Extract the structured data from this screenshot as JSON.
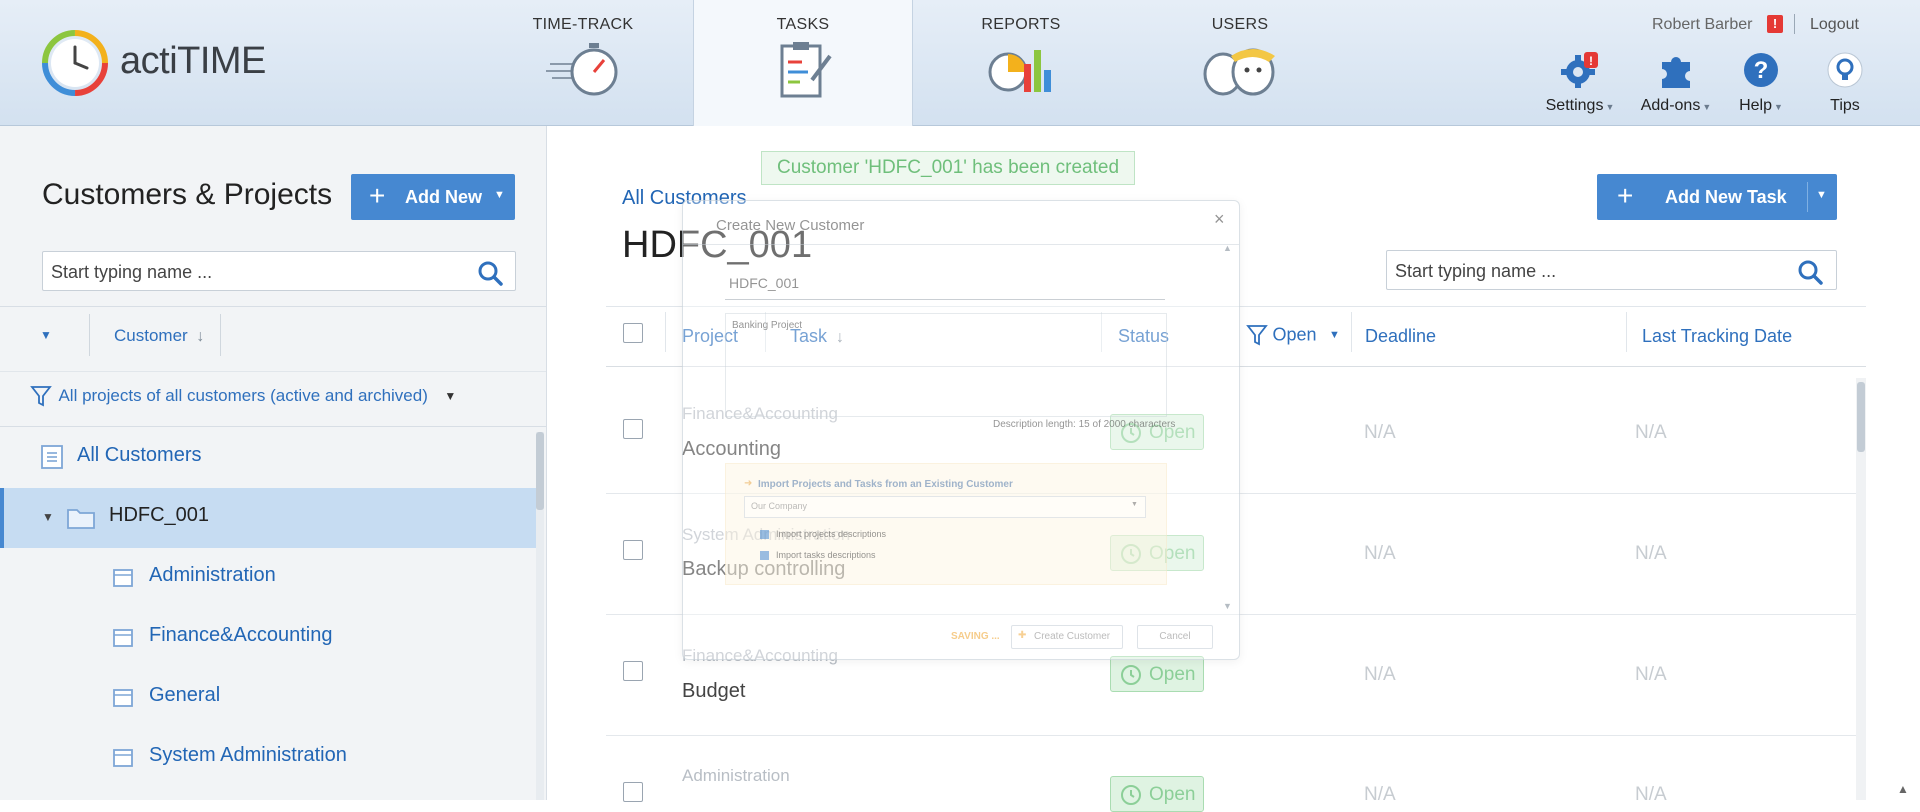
{
  "header": {
    "logo_text": "actiTIME",
    "tabs": [
      {
        "label": "TIME-TRACK"
      },
      {
        "label": "TASKS"
      },
      {
        "label": "REPORTS"
      },
      {
        "label": "USERS"
      }
    ],
    "user_name": "Robert Barber",
    "logout_label": "Logout",
    "tools": [
      {
        "label": "Settings"
      },
      {
        "label": "Add-ons"
      },
      {
        "label": "Help"
      },
      {
        "label": "Tips"
      }
    ]
  },
  "left_panel": {
    "title": "Customers & Projects",
    "add_new_label": "Add New",
    "search_placeholder": "Start typing name ...",
    "sort_label": "Customer",
    "filter_label": "All projects of all customers (active and archived)",
    "tree": {
      "all_customers": "All Customers",
      "customer": "HDFC_001",
      "projects": [
        "Administration",
        "Finance&Accounting",
        "General",
        "System Administration"
      ]
    }
  },
  "main": {
    "breadcrumb": "All Customers",
    "title": "HDFC_001",
    "add_task_label": "Add New Task",
    "search_placeholder": "Start typing name ...",
    "columns": {
      "project": "Project",
      "task": "Task",
      "status": "Status",
      "status_filter": "Open",
      "deadline": "Deadline",
      "last_tracking": "Last Tracking Date"
    },
    "rows": [
      {
        "project": "Finance&Accounting",
        "task": "Accounting",
        "status": "Open",
        "deadline": "N/A",
        "last_tracking": "N/A"
      },
      {
        "project": "System Administration",
        "task": "Backup controlling",
        "status": "Open",
        "deadline": "N/A",
        "last_tracking": "N/A"
      },
      {
        "project": "Finance&Accounting",
        "task": "Budget",
        "status": "Open",
        "deadline": "N/A",
        "last_tracking": "N/A"
      },
      {
        "project": "Administration",
        "task": "",
        "status": "Open",
        "deadline": "N/A",
        "last_tracking": "N/A"
      }
    ]
  },
  "toast": "Customer 'HDFC_001' has been created",
  "modal": {
    "title": "Create New Customer",
    "close_glyph": "×",
    "name_value": "HDFC_001",
    "description_value": "Banking Project",
    "description_length": "Description length: 15 of 2000 characters",
    "import_title": "Import Projects and Tasks from an Existing Customer",
    "import_select": "Our Company",
    "import_projects_label": "Import projects descriptions",
    "import_tasks_label": "Import tasks descriptions",
    "saving_label": "SAVING ...",
    "create_label": "Create Customer",
    "cancel_label": "Cancel"
  },
  "colors": {
    "brand_blue": "#4688d1",
    "link_blue": "#2266b5",
    "status_green": "#8ccf98",
    "toast_green": "#6fbf7b",
    "alert_red": "#e53935"
  },
  "icons": [
    "clock-logo-icon",
    "stopwatch-icon",
    "clipboard-icon",
    "pie-chart-icon",
    "users-icon",
    "gear-icon",
    "puzzle-icon",
    "help-icon",
    "bulb-icon",
    "search-icon",
    "filter-icon",
    "folder-icon",
    "project-icon",
    "list-icon"
  ]
}
